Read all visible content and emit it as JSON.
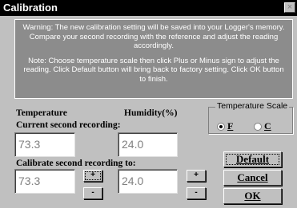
{
  "window": {
    "title": "Calibration",
    "close_glyph": "×"
  },
  "notice": {
    "warning": "Warning: The new calibration setting will be saved into your Logger's memory. Compare your second recording with the reference and adjust the reading accordingly.",
    "note": "Note: Choose temperature scale then click Plus or Minus sign to adjust the reading. Click Default button will bring back to factory setting. Click OK button to finish."
  },
  "labels": {
    "temperature": "Temperature",
    "humidity": "Humidity(%)",
    "current_recording": "Current second recording:",
    "calibrate_recording": "Calibrate second recording to:"
  },
  "current": {
    "temperature": "73.3",
    "humidity": "24.0"
  },
  "calibrate": {
    "temperature": "73.3",
    "humidity": "24.0"
  },
  "adjust": {
    "plus": "+",
    "minus": "-"
  },
  "temperature_scale": {
    "title": "Temperature Scale",
    "options": [
      "F",
      "C"
    ],
    "selected": "F"
  },
  "buttons": {
    "default": "Default",
    "cancel": "Cancel",
    "ok": "OK"
  },
  "colors": {
    "dialog_bg": "#c0c0c0",
    "titlebar": "#000000",
    "notice_bg": "#8c8c8c",
    "field_text": "#808080"
  }
}
